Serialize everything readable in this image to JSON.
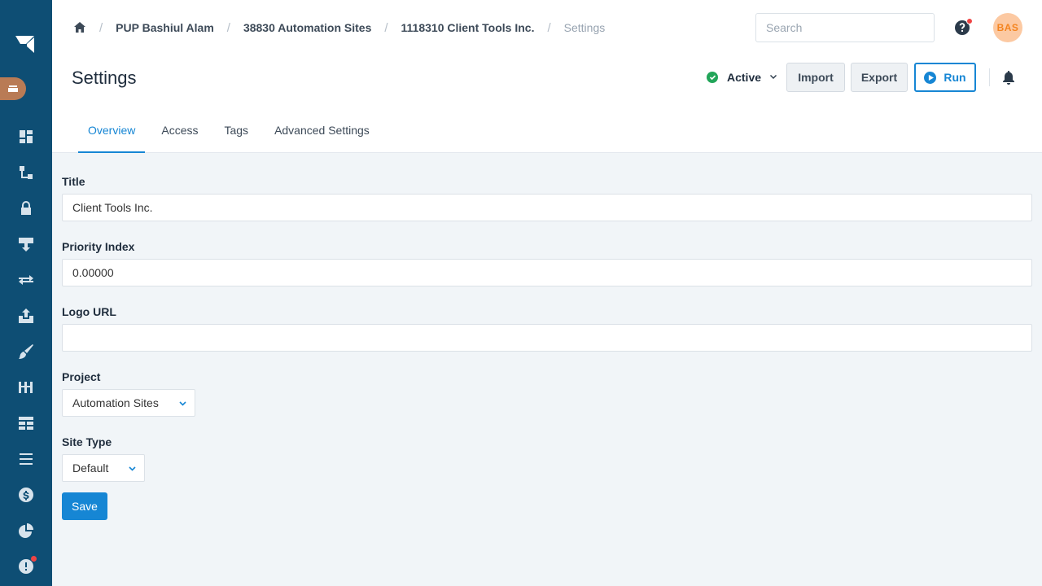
{
  "sidebar": {
    "icons": [
      "logo-icon",
      "workspace-icon",
      "dashboard-icon",
      "sitemap-icon",
      "lock-icon",
      "inbox-download-icon",
      "exchange-icon",
      "upload-icon",
      "brush-icon",
      "timeline-icon",
      "table-icon",
      "list-icon",
      "dollar-icon",
      "pie-chart-icon",
      "alert-icon"
    ]
  },
  "breadcrumb": {
    "items": [
      "PUP Bashiul Alam",
      "38830 Automation Sites",
      "1118310 Client Tools Inc."
    ],
    "current": "Settings"
  },
  "header": {
    "search_placeholder": "Search",
    "avatar_initials": "BAS",
    "page_title": "Settings",
    "status": "Active",
    "import_label": "Import",
    "export_label": "Export",
    "run_label": "Run"
  },
  "tabs": [
    "Overview",
    "Access",
    "Tags",
    "Advanced Settings"
  ],
  "active_tab": "Overview",
  "form": {
    "title_label": "Title",
    "title_value": "Client Tools Inc.",
    "priority_label": "Priority Index",
    "priority_value": "0.00000",
    "logo_label": "Logo URL",
    "logo_value": "",
    "project_label": "Project",
    "project_value": "Automation Sites",
    "site_type_label": "Site Type",
    "site_type_value": "Default",
    "save_label": "Save"
  },
  "colors": {
    "sidebar": "#0e4e74",
    "accent": "#1686d4",
    "status_green": "#22a559",
    "notification_red": "#ef4444",
    "avatar_bg": "#fcc9a2",
    "avatar_text": "#f4841f"
  }
}
